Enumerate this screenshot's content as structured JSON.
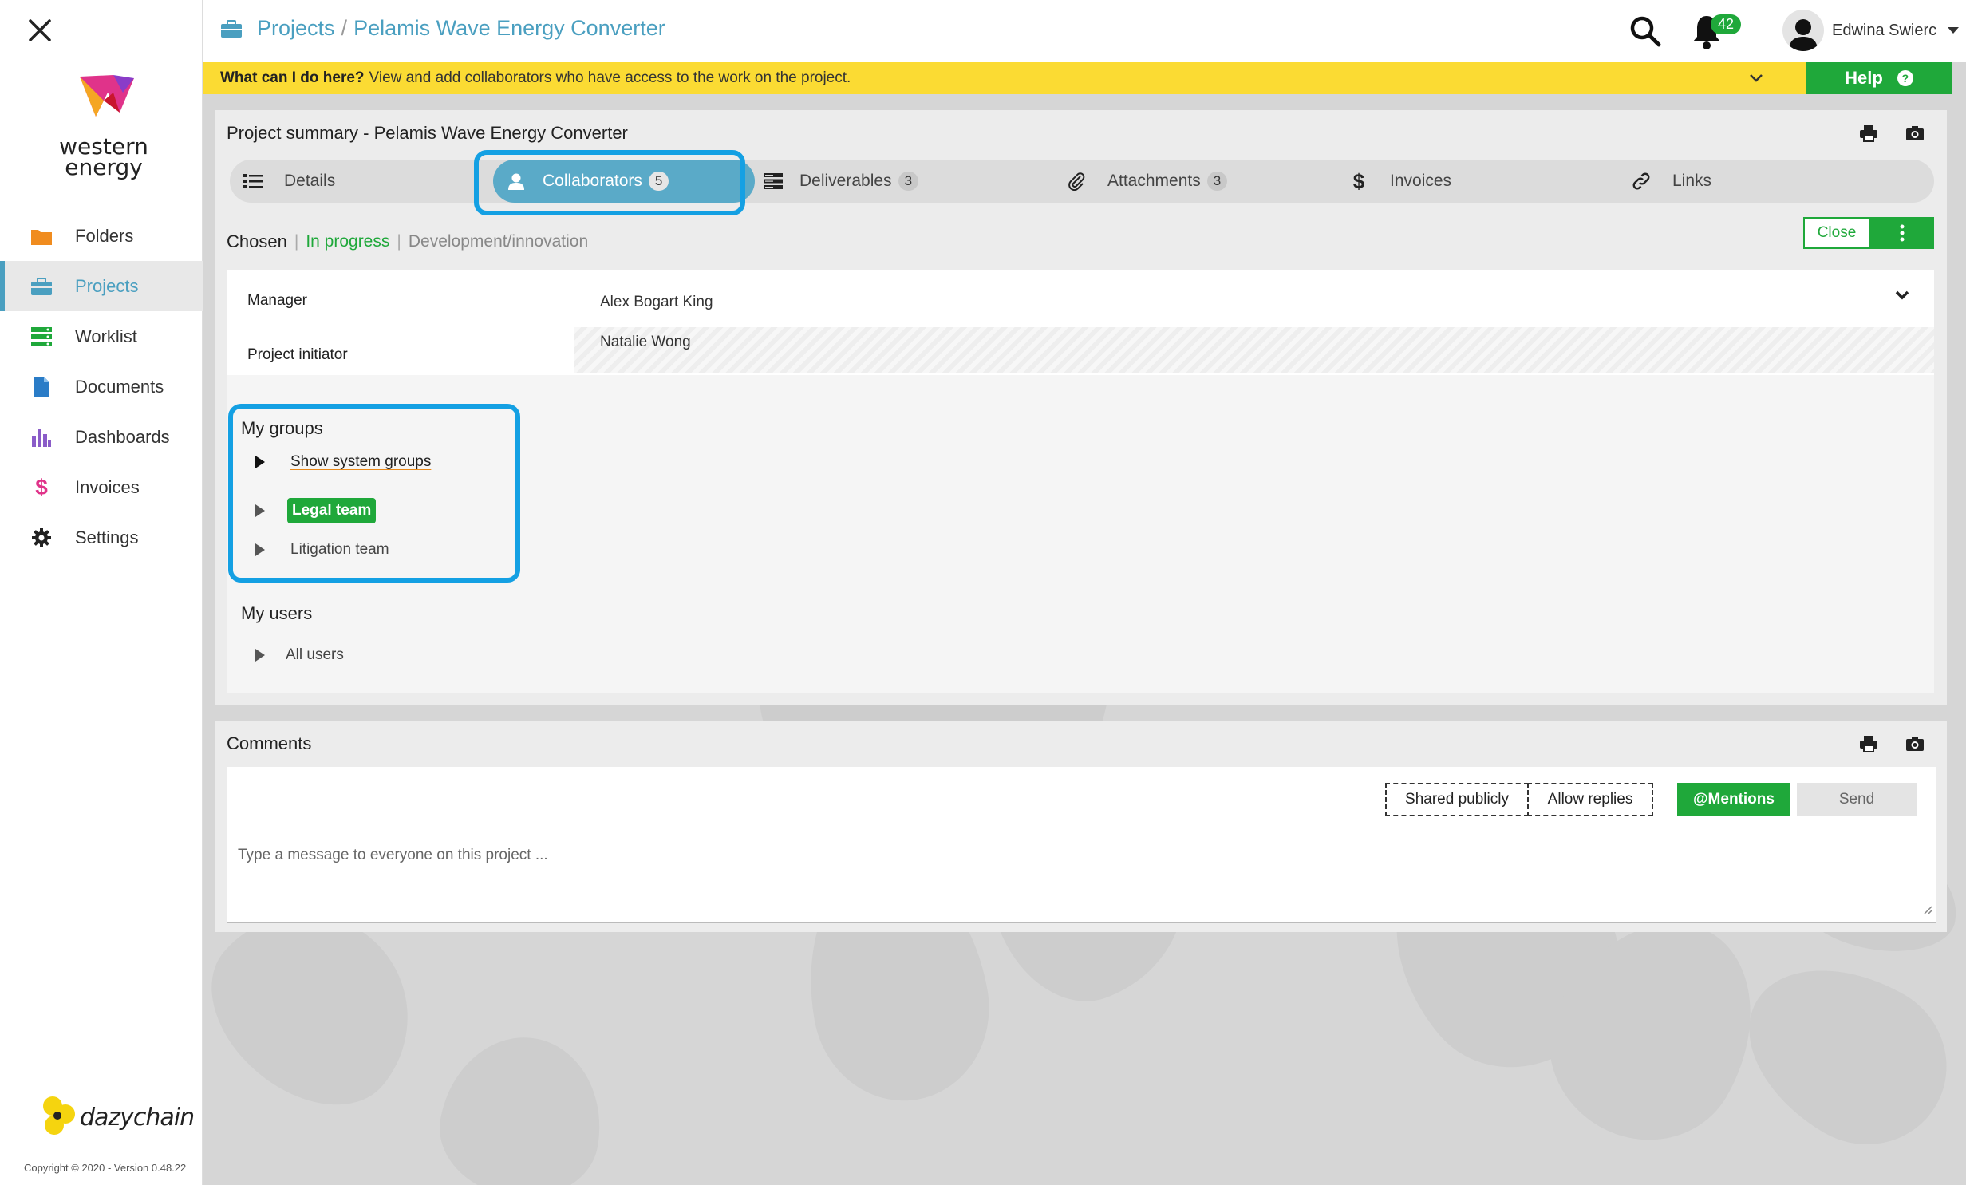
{
  "header": {
    "breadcrumb_root": "Projects",
    "breadcrumb_sep": "/",
    "breadcrumb_current": "Pelamis Wave Energy Converter",
    "notifications_count": "42",
    "user_name": "Edwina Swierc"
  },
  "sidebar": {
    "logo_line1": "western",
    "logo_line2": "energy",
    "items": [
      {
        "label": "Folders",
        "icon": "folder-icon",
        "color": "#f08c1f"
      },
      {
        "label": "Projects",
        "icon": "briefcase-icon",
        "color": "#4a9fc0",
        "active": true
      },
      {
        "label": "Worklist",
        "icon": "worklist-icon",
        "color": "#1fa83a"
      },
      {
        "label": "Documents",
        "icon": "document-icon",
        "color": "#2a7cc7"
      },
      {
        "label": "Dashboards",
        "icon": "bar-chart-icon",
        "color": "#8a5cc8"
      },
      {
        "label": "Invoices",
        "icon": "dollar-icon",
        "color": "#e0338a"
      },
      {
        "label": "Settings",
        "icon": "gear-icon",
        "color": "#333333"
      }
    ],
    "brand": "dazychain",
    "copyright": "Copyright © 2020 - Version 0.48.22"
  },
  "helpbar": {
    "question": "What can I do here?",
    "text": "View and add collaborators who have access to the work on the project.",
    "help_label": "Help"
  },
  "panel": {
    "title": "Project summary - Pelamis Wave Energy Converter",
    "tabs": [
      {
        "label": "Details",
        "count": ""
      },
      {
        "label": "Collaborators",
        "count": "5",
        "active": true
      },
      {
        "label": "Deliverables",
        "count": "3"
      },
      {
        "label": "Attachments",
        "count": "3"
      },
      {
        "label": "Invoices",
        "count": ""
      },
      {
        "label": "Links",
        "count": ""
      }
    ],
    "status": {
      "stage": "Chosen",
      "state": "In progress",
      "type": "Development/innovation",
      "sep": "|"
    },
    "close_label": "Close",
    "manager_label": "Manager",
    "manager_value": "Alex Bogart King",
    "initiator_label": "Project initiator",
    "initiator_value": "Natalie Wong",
    "my_groups_title": "My groups",
    "groups": [
      {
        "label": "Show system groups"
      },
      {
        "label": "Legal team"
      },
      {
        "label": "Litigation team"
      }
    ],
    "my_users_title": "My users",
    "users": [
      {
        "label": "All users"
      }
    ]
  },
  "comments": {
    "title": "Comments",
    "shared_label": "Shared publicly",
    "replies_label": "Allow replies",
    "mentions_label": "@Mentions",
    "send_label": "Send",
    "placeholder": "Type a message to everyone on this project ..."
  },
  "colors": {
    "accent": "#4a9fc0",
    "green": "#1fa83a",
    "help_yellow": "#fbdb33",
    "highlight": "#14a0e3"
  }
}
